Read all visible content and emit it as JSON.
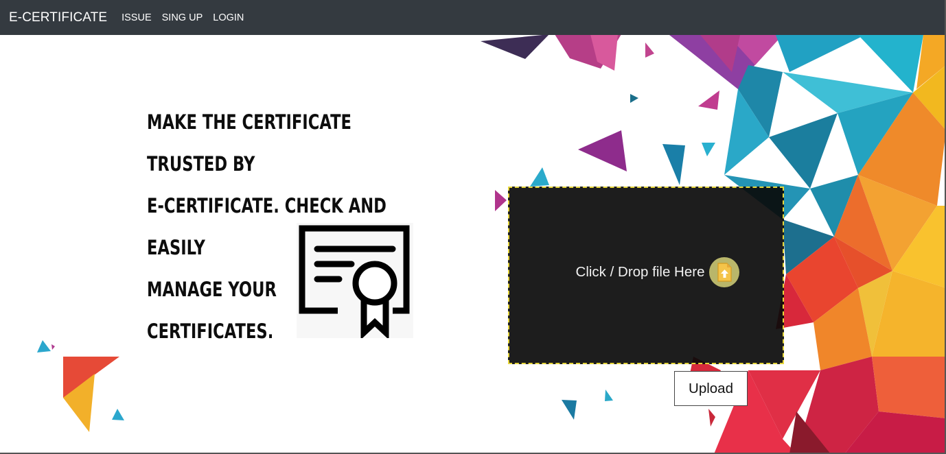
{
  "navbar": {
    "brand": "E-CERTIFICATE",
    "links": [
      "ISSUE",
      "SING UP",
      "LOGIN"
    ]
  },
  "hero": {
    "lines": [
      "MAKE THE CERTIFICATE TRUSTED BY",
      "E-CERTIFICATE. CHECK AND EASILY",
      "MANAGE YOUR CERTIFICATES."
    ]
  },
  "dropzone": {
    "label": "Click / Drop file Here",
    "icon": "file-upload-icon"
  },
  "upload_button": {
    "label": "Upload"
  },
  "colors": {
    "navbar_bg": "#343a40",
    "dropzone_bg": "#0a0a0a",
    "dropzone_border": "#e6d63a",
    "upload_icon_badge": "#b9b66a"
  }
}
